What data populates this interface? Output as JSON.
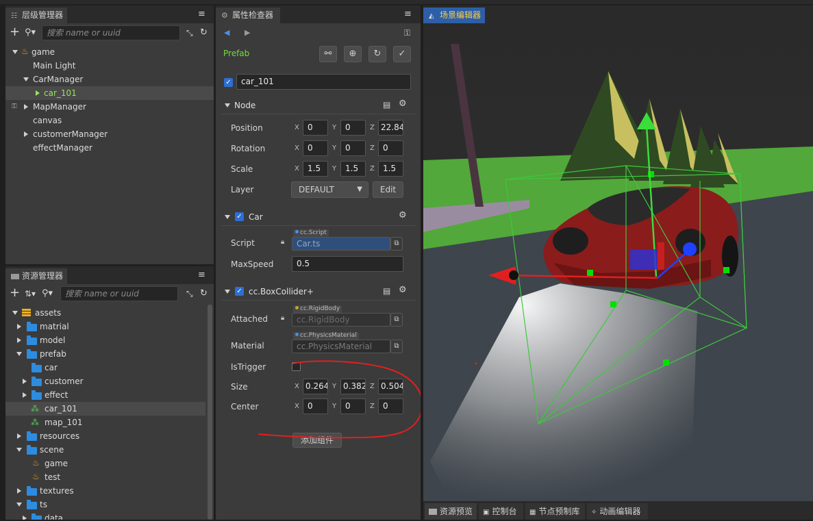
{
  "hierarchy": {
    "title": "层级管理器",
    "search_placeholder": "搜索 name or uuid",
    "nodes": [
      {
        "label": "game"
      },
      {
        "label": "Main Light"
      },
      {
        "label": "CarManager"
      },
      {
        "label": "car_101"
      },
      {
        "label": "MapManager"
      },
      {
        "label": "canvas"
      },
      {
        "label": "customerManager"
      },
      {
        "label": "effectManager"
      }
    ]
  },
  "assets": {
    "title": "资源管理器",
    "search_placeholder": "搜索 name or uuid",
    "items": [
      {
        "label": "assets"
      },
      {
        "label": "matrial"
      },
      {
        "label": "model"
      },
      {
        "label": "prefab"
      },
      {
        "label": "car"
      },
      {
        "label": "customer"
      },
      {
        "label": "effect"
      },
      {
        "label": "car_101"
      },
      {
        "label": "map_101"
      },
      {
        "label": "resources"
      },
      {
        "label": "scene"
      },
      {
        "label": "game"
      },
      {
        "label": "test"
      },
      {
        "label": "textures"
      },
      {
        "label": "ts"
      },
      {
        "label": "data"
      }
    ]
  },
  "inspector": {
    "title": "属性检查器",
    "prefab_label": "Prefab",
    "node_name": "car_101",
    "node_section": {
      "title": "Node",
      "position_label": "Position",
      "position": {
        "x": "0",
        "y": "0",
        "z": "22.84"
      },
      "rotation_label": "Rotation",
      "rotation": {
        "x": "0",
        "y": "0",
        "z": "0"
      },
      "scale_label": "Scale",
      "scale": {
        "x": "1.5",
        "y": "1.5",
        "z": "1.5"
      },
      "layer_label": "Layer",
      "layer_value": "DEFAULT",
      "edit_label": "Edit"
    },
    "car_section": {
      "title": "Car",
      "script_label": "Script",
      "script_tag": "cc.Script",
      "script_value": "Car.ts",
      "maxspeed_label": "MaxSpeed",
      "maxspeed_value": "0.5"
    },
    "collider_section": {
      "title": "cc.BoxCollider+",
      "attached_label": "Attached",
      "attached_tag": "cc.RigidBody",
      "attached_value": "cc.RigidBody",
      "material_label": "Material",
      "material_tag": "cc.PhysicsMaterial",
      "material_value": "cc.PhysicsMaterial",
      "istrigger_label": "IsTrigger",
      "size_label": "Size",
      "size": {
        "x": "0.264",
        "y": "0.382",
        "z": "0.504"
      },
      "center_label": "Center",
      "center": {
        "x": "0",
        "y": "0",
        "z": "0"
      }
    },
    "axis": {
      "x": "X",
      "y": "Y",
      "z": "Z"
    },
    "add_component_label": "添加组件"
  },
  "scene": {
    "title": "场景编辑器"
  },
  "bottom_tabs": [
    {
      "label": "资源预览"
    },
    {
      "label": "控制台"
    },
    {
      "label": "节点预制库"
    },
    {
      "label": "动画编辑器"
    }
  ],
  "colors": {
    "accent_blue": "#2d6fd2",
    "prefab_green": "#9ce35b",
    "annotation_red": "#e02020"
  }
}
